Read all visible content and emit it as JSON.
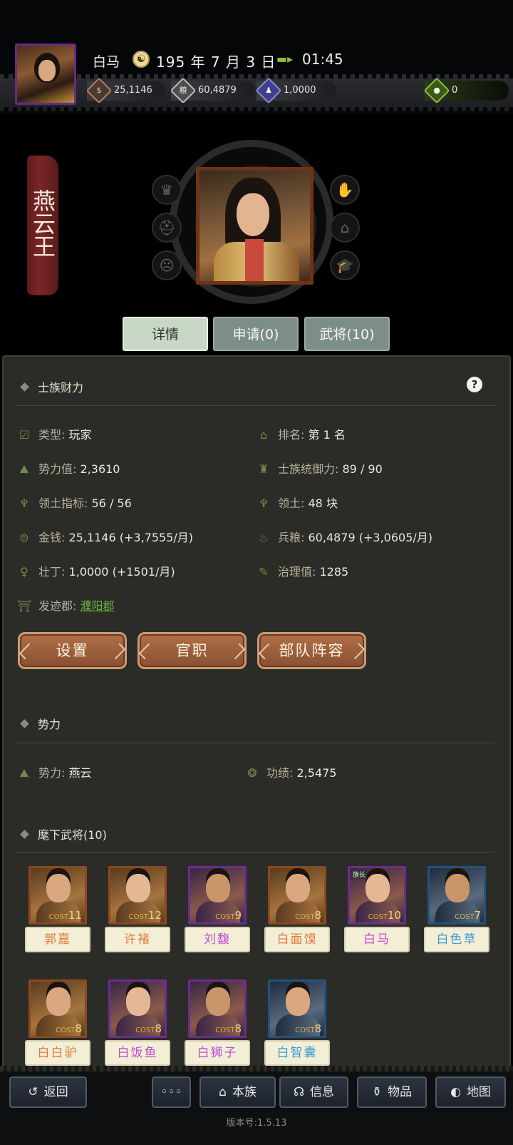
{
  "player": {
    "name": "白马",
    "date_icon_glyph": "☯",
    "date": "195 年 7 月 3 日",
    "time": "01:45",
    "title_banner": "燕云王"
  },
  "resources": {
    "money": {
      "icon": "coin-icon",
      "glyph": "$",
      "value": "25,1146"
    },
    "food": {
      "icon": "grain-icon",
      "glyph": "粮",
      "value": "60,4879"
    },
    "people": {
      "icon": "manpower-icon",
      "glyph": "♟",
      "value": "1,0000"
    },
    "bag": {
      "icon": "pouch-icon",
      "glyph": "●",
      "value": "0"
    }
  },
  "side_icons": {
    "left": [
      "crown-icon",
      "helmet-icon",
      "mask-icon"
    ],
    "right": [
      "hand-coin-icon",
      "hat-icon",
      "graduation-cap-icon"
    ],
    "left_glyphs": [
      "♛",
      "⛑",
      "☹"
    ],
    "right_glyphs": [
      "✋",
      "⌂",
      "🎓"
    ]
  },
  "tabs": [
    "详情",
    "申请(0)",
    "武将(10)"
  ],
  "sections": {
    "wealth": "士族财力",
    "power": "势力",
    "generals": "麾下武将(10)"
  },
  "help_label": "?",
  "stats": {
    "type": {
      "label": "类型:",
      "value": "玩家"
    },
    "rank": {
      "label": "排名:",
      "value": "第 1 名"
    },
    "power": {
      "label": "势力值:",
      "value": "2,3610"
    },
    "command": {
      "label": "士族统御力:",
      "value": "89 / 90"
    },
    "territory_quota": {
      "label": "领土指标:",
      "value": "56 / 56"
    },
    "territory": {
      "label": "领土:",
      "value": "48 块"
    },
    "money": {
      "label": "金钱:",
      "value": "25,1146 (+3,7555/月)"
    },
    "food": {
      "label": "兵粮:",
      "value": "60,4879 (+3,0605/月)"
    },
    "manpower": {
      "label": "壮丁:",
      "value": "1,0000 (+1501/月)"
    },
    "governance": {
      "label": "治理值:",
      "value": "1285"
    },
    "origin": {
      "label": "发迹郡:",
      "value": "濮阳郡"
    },
    "faction": {
      "label": "势力:",
      "value": "燕云"
    },
    "merit": {
      "label": "功绩:",
      "value": "2,5475"
    }
  },
  "actions": [
    "设置",
    "官职",
    "部队阵容"
  ],
  "generals": [
    {
      "name": "郭嘉",
      "cost": "11",
      "quality": "orange"
    },
    {
      "name": "许褚",
      "cost": "12",
      "quality": "orange"
    },
    {
      "name": "刘馥",
      "cost": "9",
      "quality": "purple"
    },
    {
      "name": "白面馍",
      "cost": "8",
      "quality": "orange"
    },
    {
      "name": "白马",
      "cost": "10",
      "quality": "purple",
      "chief": "族长"
    },
    {
      "name": "白色草",
      "cost": "7",
      "quality": "blue"
    },
    {
      "name": "白白驴",
      "cost": "8",
      "quality": "orange"
    },
    {
      "name": "白饭鱼",
      "cost": "8",
      "quality": "purple"
    },
    {
      "name": "白狮子",
      "cost": "8",
      "quality": "purple"
    },
    {
      "name": "白智囊",
      "cost": "8",
      "quality": "blue"
    }
  ],
  "cost_label": "COST",
  "nav": {
    "back": "返回",
    "more": "◦◦◦",
    "clan": "本族",
    "info": "信息",
    "items": "物品",
    "map": "地图"
  },
  "version": "版本号:1.5.13"
}
